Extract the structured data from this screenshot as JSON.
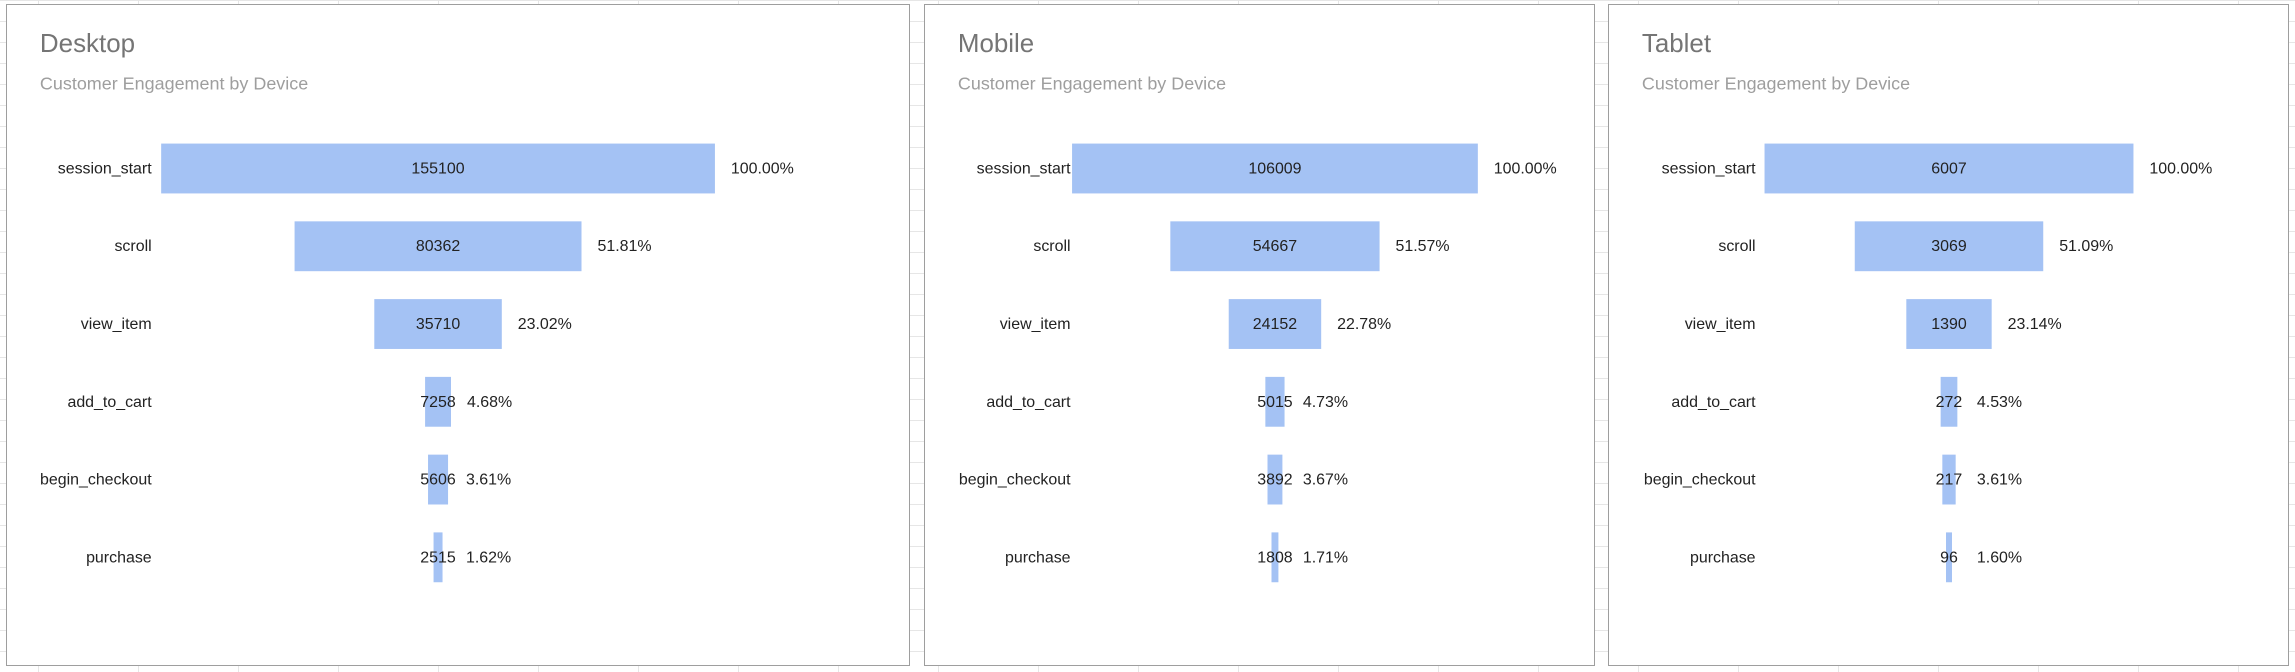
{
  "chart_data": [
    {
      "type": "bar",
      "subtype": "funnel",
      "title": "Desktop",
      "subtitle": "Customer Engagement by Device",
      "categories": [
        "session_start",
        "scroll",
        "view_item",
        "add_to_cart",
        "begin_checkout",
        "purchase"
      ],
      "values": [
        155100,
        80362,
        35710,
        7258,
        5606,
        2515
      ],
      "percent_labels": [
        "100.00%",
        "51.81%",
        "23.02%",
        "4.68%",
        "3.61%",
        "1.62%"
      ],
      "bar_color": "#a4c2f4",
      "grid": false
    },
    {
      "type": "bar",
      "subtype": "funnel",
      "title": "Mobile",
      "subtitle": "Customer Engagement by Device",
      "categories": [
        "session_start",
        "scroll",
        "view_item",
        "add_to_cart",
        "begin_checkout",
        "purchase"
      ],
      "values": [
        106009,
        54667,
        24152,
        5015,
        3892,
        1808
      ],
      "percent_labels": [
        "100.00%",
        "51.57%",
        "22.78%",
        "4.73%",
        "3.67%",
        "1.71%"
      ],
      "bar_color": "#a4c2f4",
      "grid": false
    },
    {
      "type": "bar",
      "subtype": "funnel",
      "title": "Tablet",
      "subtitle": "Customer Engagement by Device",
      "categories": [
        "session_start",
        "scroll",
        "view_item",
        "add_to_cart",
        "begin_checkout",
        "purchase"
      ],
      "values": [
        6007,
        3069,
        1390,
        272,
        217,
        96
      ],
      "percent_labels": [
        "100.00%",
        "51.09%",
        "23.14%",
        "4.53%",
        "3.61%",
        "1.60%"
      ],
      "bar_color": "#a4c2f4",
      "grid": false
    }
  ]
}
